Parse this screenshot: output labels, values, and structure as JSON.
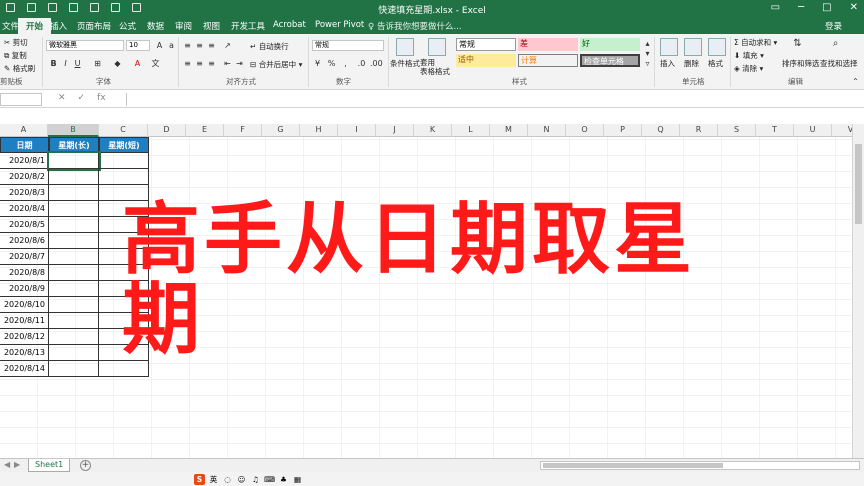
{
  "window": {
    "title": "快速填充星期.xlsx - Excel"
  },
  "tabs": [
    "开始",
    "插入",
    "页面布局",
    "公式",
    "数据",
    "审阅",
    "视图",
    "开发工具",
    "Acrobat",
    "Power Pivot"
  ],
  "tell_me": "告诉我你想要做什么...",
  "login": "登录",
  "ribbon": {
    "clipboard": {
      "cut": "剪切",
      "copy": "复制",
      "painter": "格式刷",
      "label": "剪贴板"
    },
    "font": {
      "name": "微软雅黑",
      "size": "10",
      "label": "字体"
    },
    "alignment": {
      "wrap": "自动换行",
      "merge": "合并后居中",
      "label": "对齐方式"
    },
    "number": {
      "format": "常规",
      "label": "数字"
    },
    "styles": {
      "conditional": "条件格式",
      "table": "套用\n表格格式",
      "cells": [
        "常规",
        "差",
        "好",
        "适中",
        "计算",
        "检查单元格"
      ],
      "label": "样式"
    },
    "cells_group": {
      "insert": "插入",
      "delete": "删除",
      "format": "格式",
      "label": "单元格"
    },
    "editing": {
      "autosum": "自动求和",
      "fill": "填充",
      "clear": "清除",
      "sort": "排序和筛选",
      "find": "查找和选择",
      "label": "编辑"
    }
  },
  "formula_bar": {
    "fx": "fx"
  },
  "columns": [
    "A",
    "B",
    "C",
    "D",
    "E",
    "F",
    "G",
    "H",
    "I",
    "J",
    "K",
    "L",
    "M",
    "N",
    "O",
    "P",
    "Q",
    "R",
    "S",
    "T",
    "U",
    "V"
  ],
  "table": {
    "headers": [
      "日期",
      "星期(长)",
      "星期(短)"
    ],
    "dates": [
      "2020/8/1",
      "2020/8/2",
      "2020/8/3",
      "2020/8/4",
      "2020/8/5",
      "2020/8/6",
      "2020/8/7",
      "2020/8/8",
      "2020/8/9",
      "2020/8/10",
      "2020/8/11",
      "2020/8/12",
      "2020/8/13",
      "2020/8/14"
    ]
  },
  "overlay_title": "高手从日期取星期",
  "sheet": {
    "name": "Sheet1",
    "add": "+"
  },
  "ime": {
    "logo": "S",
    "lang": "英"
  },
  "colors": {
    "excel_green": "#217346",
    "header_blue": "#1f7fc1",
    "overlay_red": "#ff1a1a"
  }
}
